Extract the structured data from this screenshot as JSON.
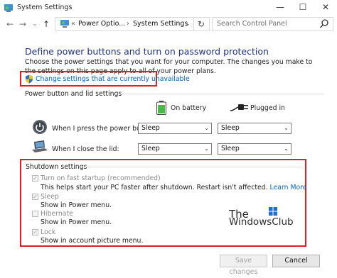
{
  "window": {
    "title": "System Settings",
    "controls": {
      "minimize": "—",
      "maximize": "☐",
      "close": "✕"
    }
  },
  "nav": {
    "back": "←",
    "forward": "→",
    "recent": "⌄",
    "up": "↑"
  },
  "address": {
    "prefix": "«",
    "crumbs": [
      "Power Optio...",
      "System Settings"
    ],
    "separator": "›",
    "dropdown": "⌄",
    "refresh": "↻"
  },
  "search": {
    "placeholder": "Search Control Panel",
    "icon": "search-icon"
  },
  "main": {
    "heading": "Define power buttons and turn on password protection",
    "intro": "Choose the power settings that you want for your computer. The changes you make to the settings on this page apply to all of your power plans.",
    "change_link": "Change settings that are currently unavailable"
  },
  "power_section": {
    "title": "Power button and lid settings",
    "columns": [
      "On battery",
      "Plugged in"
    ],
    "rows": [
      {
        "label": "When I press the power button:",
        "battery": "Sleep",
        "plugged": "Sleep",
        "icon": "power-button-icon"
      },
      {
        "label": "When I close the lid:",
        "battery": "Sleep",
        "plugged": "Sleep",
        "icon": "laptop-lid-icon"
      }
    ]
  },
  "shutdown_section": {
    "title": "Shutdown settings",
    "options": [
      {
        "label": "Turn on fast startup (recommended)",
        "checked": true,
        "desc": "This helps start your PC faster after shutdown. Restart isn't affected.",
        "link": "Learn More"
      },
      {
        "label": "Sleep",
        "checked": true,
        "desc": "Show in Power menu."
      },
      {
        "label": "Hibernate",
        "checked": false,
        "desc": "Show in Power menu."
      },
      {
        "label": "Lock",
        "checked": true,
        "desc": "Show in account picture menu."
      }
    ]
  },
  "watermark": {
    "line1": "The",
    "line2": "WindowsClub"
  },
  "buttons": {
    "save": "Save changes",
    "cancel": "Cancel"
  },
  "colors": {
    "heading": "#1e3287",
    "link": "#0066cc",
    "highlight": "#e02020"
  }
}
